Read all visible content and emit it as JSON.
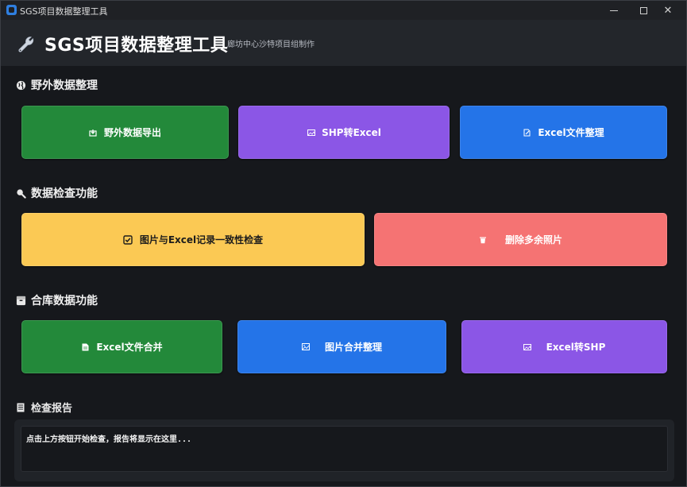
{
  "window": {
    "title": "SGS项目数据整理工具"
  },
  "header": {
    "title": "SGS项目数据整理工具",
    "subtitle": "廊坊中心沙特项目组制作"
  },
  "sections": {
    "field": {
      "title": "野外数据整理",
      "icon": "globe-icon",
      "buttons": [
        {
          "label": "野外数据导出",
          "icon": "export-icon",
          "color": "#23893a"
        },
        {
          "label": "SHP转Excel",
          "icon": "image-icon",
          "color": "#8b56e6"
        },
        {
          "label": "Excel文件整理",
          "icon": "edit-file-icon",
          "color": "#2474e8"
        }
      ]
    },
    "check": {
      "title": "数据检查功能",
      "icon": "magnifier-icon",
      "buttons": [
        {
          "label": "图片与Excel记录一致性检查",
          "icon": "checkbox-icon",
          "color": "#fbc954"
        },
        {
          "label": "删除多余照片",
          "icon": "trash-icon",
          "color": "#f57373"
        }
      ]
    },
    "warehouse": {
      "title": "合库数据功能",
      "icon": "box-icon",
      "buttons": [
        {
          "label": "Excel文件合并",
          "icon": "document-icon",
          "color": "#23893a"
        },
        {
          "label": "图片合并整理",
          "icon": "picture-icon",
          "color": "#2474e8"
        },
        {
          "label": "Excel转SHP",
          "icon": "image-icon",
          "color": "#8b56e6"
        }
      ]
    }
  },
  "report": {
    "title": "检查报告",
    "icon": "report-icon",
    "placeholder": "点击上方按钮开始检查，报告将显示在这里..."
  }
}
